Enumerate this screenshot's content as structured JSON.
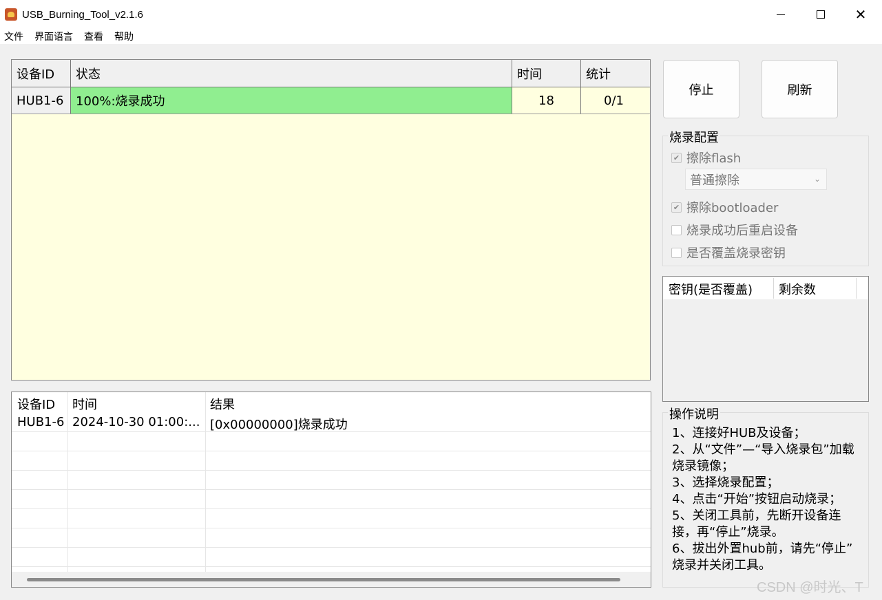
{
  "window": {
    "title": "USB_Burning_Tool_v2.1.6"
  },
  "menu": [
    "文件",
    "界面语言",
    "查看",
    "帮助"
  ],
  "device_table": {
    "headers": [
      "设备ID",
      "状态",
      "时间",
      "统计"
    ],
    "rows": [
      {
        "id": "HUB1-6",
        "status": "100%:烧录成功",
        "time": "18",
        "stat": "0/1"
      }
    ],
    "background_color": "#ffffe0",
    "success_color": "#90ee90"
  },
  "log_table": {
    "headers": [
      "设备ID",
      "时间",
      "结果"
    ],
    "rows": [
      {
        "id": "HUB1-6",
        "time": "2024-10-30 01:00:...",
        "result": "[0x00000000]烧录成功"
      }
    ]
  },
  "buttons": {
    "stop": "停止",
    "refresh": "刷新"
  },
  "burn_config": {
    "title": "烧录配置",
    "erase_flash": {
      "label": "擦除flash",
      "checked": true,
      "enabled": false
    },
    "erase_mode": "普通擦除",
    "erase_bootloader": {
      "label": "擦除bootloader",
      "checked": true,
      "enabled": false
    },
    "reboot_after": {
      "label": "烧录成功后重启设备",
      "checked": false,
      "enabled": false
    },
    "overwrite_key": {
      "label": "是否覆盖烧录密钥",
      "checked": false,
      "enabled": false
    }
  },
  "key_table": {
    "headers": [
      "密钥(是否覆盖)",
      "剩余数"
    ]
  },
  "instructions": {
    "title": "操作说明",
    "lines": [
      "1、连接好HUB及设备；",
      "2、从“文件”—“导入烧录包”加载",
      "烧录镜像；",
      "3、选择烧录配置；",
      "4、点击“开始”按钮启动烧录；",
      "5、关闭工具前，先断开设备连",
      "接，再“停止”烧录。",
      "6、拔出外置hub前，请先“停止”",
      "烧录并关闭工具。"
    ]
  },
  "watermark": "CSDN @时光、T"
}
